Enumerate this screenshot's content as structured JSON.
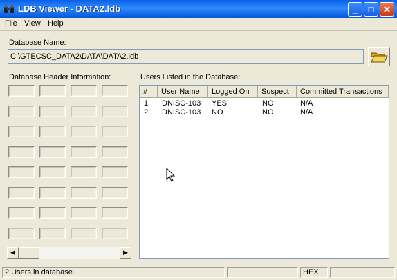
{
  "window": {
    "title": "LDB Viewer - DATA2.ldb"
  },
  "menu": [
    "File",
    "View",
    "Help"
  ],
  "database": {
    "label": "Database Name:",
    "path": "C:\\GTECSC_DATA2\\DATA\\DATA2.ldb"
  },
  "header_info": {
    "label": "Database Header Information:"
  },
  "users": {
    "label": "Users Listed in the Database:",
    "columns": [
      "#",
      "User Name",
      "Logged On",
      "Suspect",
      "Committed Transactions"
    ],
    "rows": [
      [
        "1",
        "DNISC-103",
        "YES",
        "NO",
        "N/A"
      ],
      [
        "2",
        "DNISC-103",
        "NO",
        "NO",
        "N/A"
      ]
    ]
  },
  "status": {
    "message": "2 Users in database",
    "hex": "HEX"
  }
}
